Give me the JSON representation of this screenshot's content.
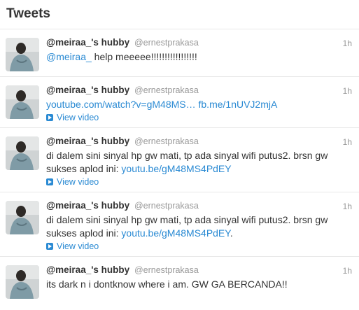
{
  "header": {
    "title": "Tweets"
  },
  "tweets": [
    {
      "fullname": "@meiraa_'s hubby",
      "username": "@ernestprakasa",
      "time": "1h",
      "mention": "@meiraa_",
      "text": " help meeeee!!!!!!!!!!!!!!!!!"
    },
    {
      "fullname": "@meiraa_'s hubby",
      "username": "@ernestprakasa",
      "time": "1h",
      "link1": "youtube.com/watch?v=gM48MS…",
      "link2": "fb.me/1nUVJ2mjA",
      "view_video": "View video"
    },
    {
      "fullname": "@meiraa_'s hubby",
      "username": "@ernestprakasa",
      "time": "1h",
      "text_line1": "di dalem sini sinyal hp gw mati, tp ada sinyal wifi putus2. brsn gw",
      "text_line2": "sukses aplod ini: ",
      "link": "youtu.be/gM48MS4PdEY",
      "view_video": "View video"
    },
    {
      "fullname": "@meiraa_'s hubby",
      "username": "@ernestprakasa",
      "time": "1h",
      "text_line1": "di dalem sini sinyal hp gw mati, tp ada sinyal wifi putus2. brsn gw",
      "text_line2": "sukses aplod ini: ",
      "link": "youtu.be/gM48MS4PdEY",
      "after_link": ".",
      "view_video": "View video"
    },
    {
      "fullname": "@meiraa_'s hubby",
      "username": "@ernestprakasa",
      "time": "1h",
      "text": "its dark n i dontknow where i am. GW GA BERCANDA!!"
    }
  ],
  "colors": {
    "link": "#2a8ad3",
    "muted": "#999999",
    "text": "#333333",
    "divider": "#e8e8e8"
  },
  "icons": {
    "avatar": "user-avatar",
    "video": "play-icon"
  }
}
